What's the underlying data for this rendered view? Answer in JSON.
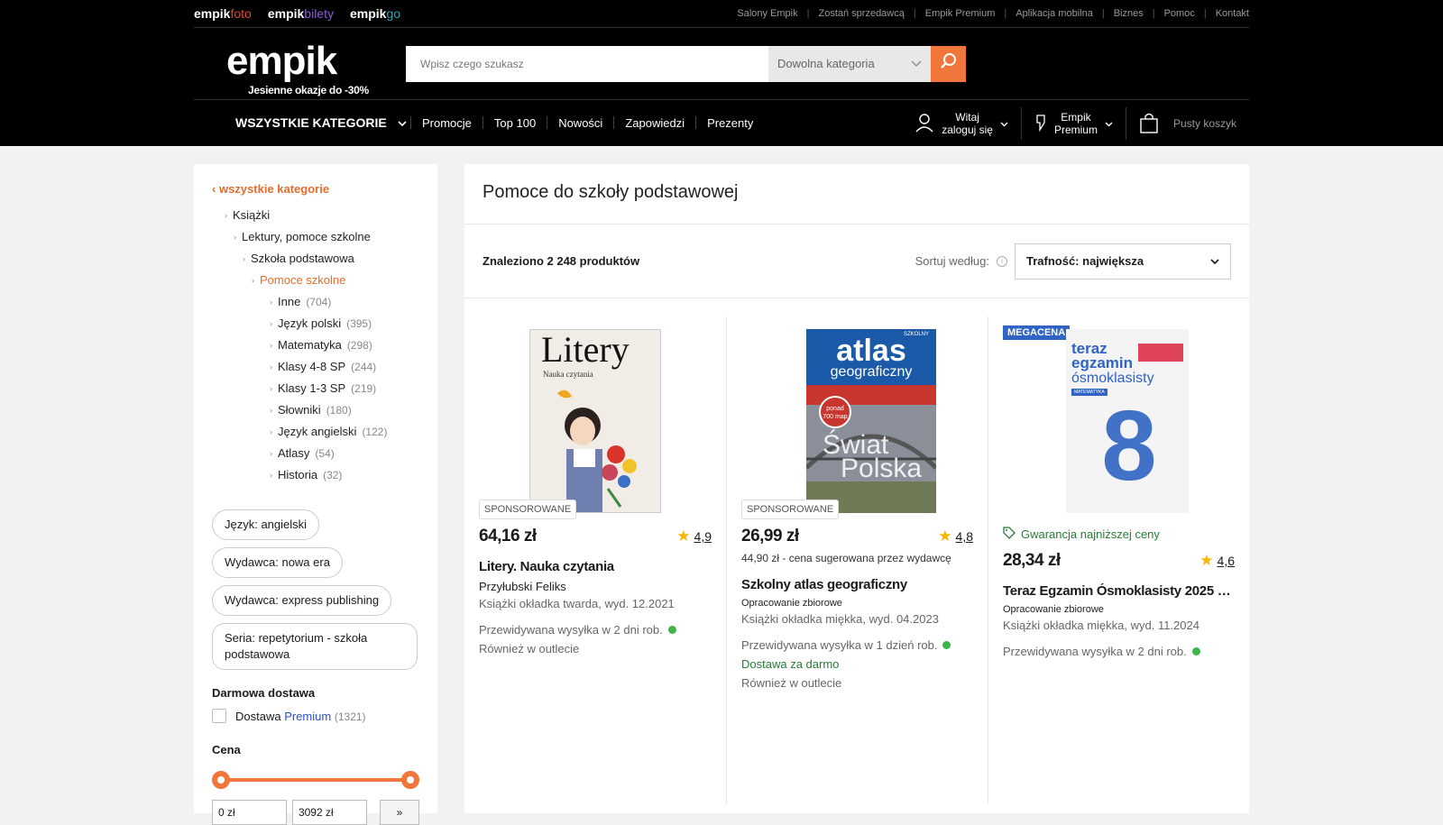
{
  "brands": [
    {
      "word": "empik",
      "sub": "foto",
      "color": "#e0452d"
    },
    {
      "word": "empik",
      "sub": "bilety",
      "color": "#8f5cd4"
    },
    {
      "word": "empik",
      "sub": "go",
      "color": "#2ea3b5"
    }
  ],
  "toplinks": [
    "Salony Empik",
    "Zostań sprzedawcą",
    "Empik Premium",
    "Aplikacja mobilna",
    "Biznes",
    "Pomoc",
    "Kontakt"
  ],
  "logo": {
    "word": "empik",
    "tagline": "Jesienne okazje do -30%"
  },
  "search": {
    "placeholder": "Wpisz czego szukasz",
    "category": "Dowolna kategoria"
  },
  "nav": {
    "all_categories": "WSZYSTKIE KATEGORIE",
    "links": [
      "Promocje",
      "Top 100",
      "Nowości",
      "Zapowiedzi",
      "Prezenty"
    ]
  },
  "user": {
    "greeting": "Witaj",
    "login": "zaloguj się",
    "premium_line1": "Empik",
    "premium_line2": "Premium",
    "cart": "Pusty koszyk"
  },
  "sidebar": {
    "back": "wszystkie kategorie",
    "tree": [
      {
        "label": "Książki",
        "level": 0
      },
      {
        "label": "Lektury, pomoce szkolne",
        "level": 1
      },
      {
        "label": "Szkoła podstawowa",
        "level": 2
      },
      {
        "label": "Pomoce szkolne",
        "level": 3,
        "active": true
      }
    ],
    "subcats": [
      {
        "label": "Inne",
        "count": "(704)"
      },
      {
        "label": "Język polski",
        "count": "(395)"
      },
      {
        "label": "Matematyka",
        "count": "(298)"
      },
      {
        "label": "Klasy 4-8 SP",
        "count": "(244)"
      },
      {
        "label": "Klasy 1-3 SP",
        "count": "(219)"
      },
      {
        "label": "Słowniki",
        "count": "(180)"
      },
      {
        "label": "Język angielski",
        "count": "(122)"
      },
      {
        "label": "Atlasy",
        "count": "(54)"
      },
      {
        "label": "Historia",
        "count": "(32)"
      }
    ],
    "chips": [
      "Język: angielski",
      "Wydawca: nowa era",
      "Wydawca: express publishing",
      "Seria: repetytorium - szkoła podstawowa"
    ],
    "free_delivery_heading": "Darmowa dostawa",
    "delivery_label": "Dostawa",
    "delivery_premium": "Premium",
    "delivery_count": "(1321)",
    "price_heading": "Cena",
    "price_min": "0 zł",
    "price_max": "3092 zł",
    "price_go": "»"
  },
  "content": {
    "title": "Pomoce do szkoły podstawowej",
    "found": "Znaleziono 2 248 produktów",
    "sort_label": "Sortuj według:",
    "sort_value": "Trafność: największa"
  },
  "products": [
    {
      "badge": "SPONSOROWANE",
      "price": "64,16 zł",
      "rating": "4,9",
      "title": "Litery. Nauka czytania",
      "author": "Przyłubski Feliks",
      "format": "Książki okładka  twarda, wyd. 12.2021",
      "shipping": "Przewidywana wysyłka  w 2 dni rob.",
      "outlet": "Również w outlecie",
      "cover_title": "Litery",
      "cover_sub": "Nauka czytania"
    },
    {
      "badge": "SPONSOROWANE",
      "price": "26,99 zł",
      "rating": "4,8",
      "suggested": "44,90 zł - cena sugerowana przez wydawcę",
      "title": "Szkolny atlas geograficzny",
      "author": "Opracowanie zbiorowe",
      "format": "Książki okładka  miękka, wyd. 04.2023",
      "shipping": "Przewidywana wysyłka  w 1 dzień rob.",
      "free_delivery": "Dostawa za darmo",
      "outlet": "Również w outlecie",
      "cover_top": "SZKOLNY",
      "cover_title": "atlas",
      "cover_title2": "geograficzny",
      "cover_badge": "ponad 700 map",
      "cover_bottom1": "Świat",
      "cover_bottom2": "Polska"
    },
    {
      "badge": "MEGACENA",
      "guarantee": "Gwarancja najniższej ceny",
      "price": "28,34 zł",
      "rating": "4,6",
      "title": "Teraz Egzamin Ósmoklasisty 2025 - 2...",
      "author": "Opracowanie zbiorowe",
      "format": "Książki okładka  miękka, wyd. 11.2024",
      "shipping": "Przewidywana wysyłka  w 2 dni rob.",
      "cover_line1": "teraz",
      "cover_line2": "egzamin",
      "cover_line3": "ósmoklasisty",
      "cover_tag": "MATEMATYKA",
      "cover_digit": "8"
    }
  ],
  "colors": {
    "accent": "#f0763c",
    "brand_orange": "#e96b2d",
    "premium_blue": "#2b50c9",
    "megacena_blue": "#2f63c4",
    "green": "#2a7a38"
  }
}
